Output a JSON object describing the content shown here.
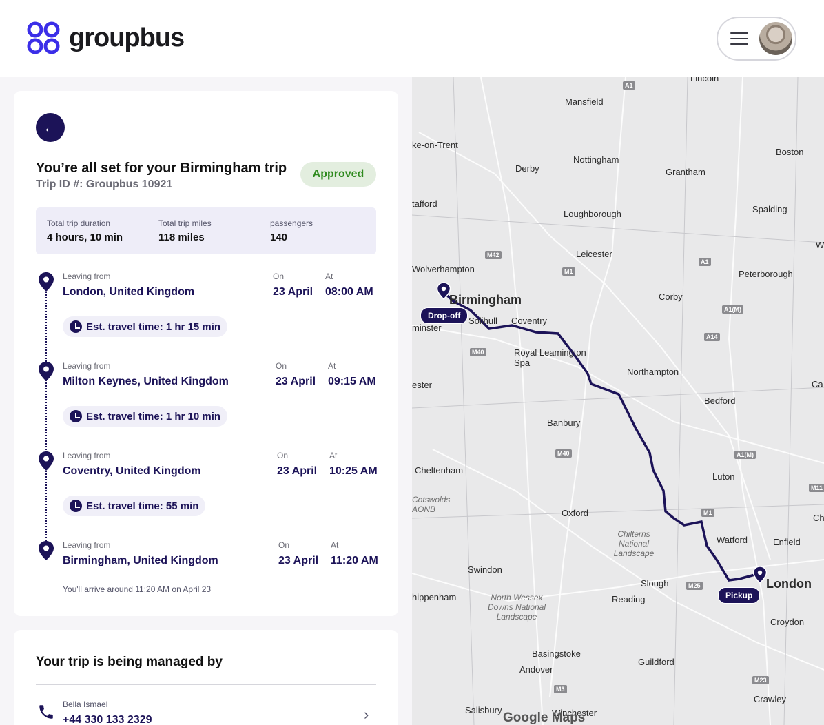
{
  "brand": {
    "name": "groupbus"
  },
  "trip": {
    "title": "You’re all set for your Birmingham trip",
    "trip_id": "Trip ID #: Groupbus 10921",
    "status": "Approved",
    "summary": [
      {
        "label": "Total trip duration",
        "value": "4 hours, 10 min"
      },
      {
        "label": "Total trip miles",
        "value": "118 miles"
      },
      {
        "label": "passengers",
        "value": "140"
      }
    ],
    "stops": [
      {
        "label": "Leaving from",
        "place": "London, United Kingdom",
        "on_label": "On",
        "date": "23 April",
        "at_label": "At",
        "time": "08:00 AM",
        "est": "Est. travel time: 1 hr 15 min"
      },
      {
        "label": "Leaving from",
        "place": "Milton Keynes, United Kingdom",
        "on_label": "On",
        "date": "23 April",
        "at_label": "At",
        "time": "09:15 AM",
        "est": "Est. travel time: 1 hr 10 min"
      },
      {
        "label": "Leaving from",
        "place": "Coventry, United Kingdom",
        "on_label": "On",
        "date": "23 April",
        "at_label": "At",
        "time": "10:25 AM",
        "est": "Est. travel time: 55 min"
      },
      {
        "label": "Leaving from",
        "place": "Birmingham, United Kingdom",
        "on_label": "On",
        "date": "23 April",
        "at_label": "At",
        "time": "11:20 AM"
      }
    ],
    "arrival_note": "You'll arrive around 11:20 AM on April 23"
  },
  "manager": {
    "heading": "Your trip is being managed by",
    "name": "Bella Ismael",
    "phone": "+44 330 133 2329"
  },
  "map": {
    "dropoff_label": "Drop-off",
    "pickup_label": "Pickup",
    "attribution": "Google Maps",
    "route_color": "#1c1358",
    "cities": [
      "Lincoln",
      "Mansfield",
      "ke-on-Trent",
      "Derby",
      "Nottingham",
      "Grantham",
      "Boston",
      "tafford",
      "Loughborough",
      "Spalding",
      "Leicester",
      "Wolverhampton",
      "Peterborough",
      "Birmingham",
      "Corby",
      "Solihull",
      "Coventry",
      "minster",
      "Royal Leamington Spa",
      "Northampton",
      "ester",
      "Bedford",
      "Banbury",
      "Cheltenham",
      "Luton",
      "Cotswolds AONB",
      "Oxford",
      "Chilterns National Landscape",
      "Watford",
      "Enfield",
      "Swindon",
      "Slough",
      "London",
      "Reading",
      "hippenham",
      "North Wessex Downs National Landscape",
      "Croydon",
      "Basingstoke",
      "Guildford",
      "Andover",
      "Salisbury",
      "Winchester",
      "Crawley",
      "Ca",
      "Ch",
      "W"
    ],
    "roads": [
      "A1",
      "M42",
      "M1",
      "A1",
      "A1(M)",
      "A14",
      "M40",
      "M40",
      "A1(M)",
      "M1",
      "M11",
      "M25",
      "M3",
      "M23"
    ]
  }
}
